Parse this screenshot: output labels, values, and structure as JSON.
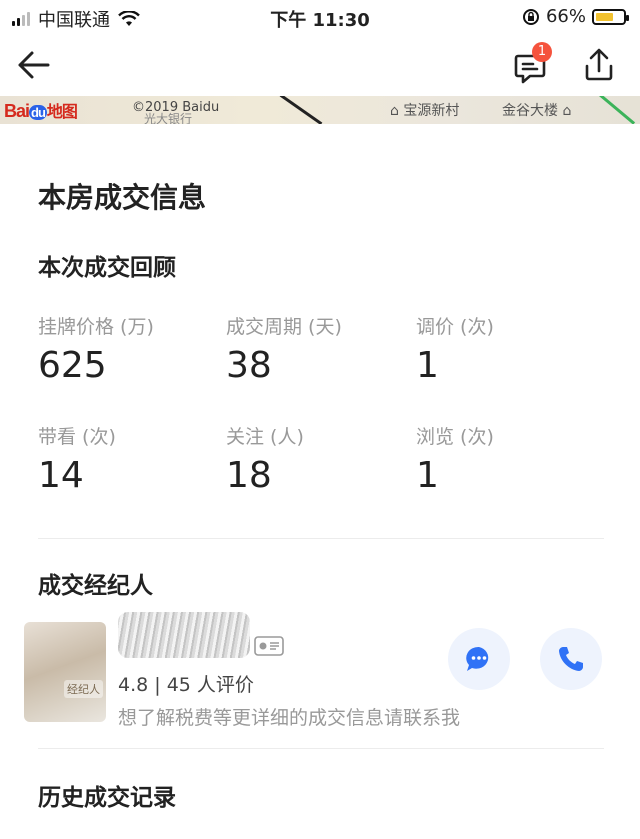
{
  "status_bar": {
    "carrier": "中国联通",
    "time": "下午 11:30",
    "battery_percent": "66%",
    "battery_level": 0.66,
    "battery_color": "#f2c230"
  },
  "nav": {
    "back_icon": "arrow-left-icon",
    "message_icon": "message-icon",
    "message_badge": "1",
    "badge_color": "#f5533d",
    "share_icon": "share-icon"
  },
  "map": {
    "logo_text": "Bai",
    "logo_du": "du",
    "logo_map": "地图",
    "copyright": "©2019 Baidu",
    "poi_bank": "光大银行",
    "poi_1": "宝源新村",
    "poi_2": "金谷大楼"
  },
  "deal": {
    "title": "本房成交信息",
    "review_title": "本次成交回顾",
    "stats": [
      {
        "label": "挂牌价格 (万)",
        "value": "625"
      },
      {
        "label": "成交周期 (天)",
        "value": "38"
      },
      {
        "label": "调价 (次)",
        "value": "1"
      },
      {
        "label": "带看 (次)",
        "value": "14"
      },
      {
        "label": "关注 (人)",
        "value": "18"
      },
      {
        "label": "浏览 (次)",
        "value": "1"
      }
    ]
  },
  "agent": {
    "section_title": "成交经纪人",
    "avatar_tag": "经纪人",
    "rating": "4.8 | 45 人评价",
    "hint": "想了解税费等更详细的成交信息请联系我",
    "chat_icon": "chat-bubble-icon",
    "phone_icon": "phone-icon",
    "accent_color": "#3072f6"
  },
  "history": {
    "title": "历史成交记录"
  }
}
